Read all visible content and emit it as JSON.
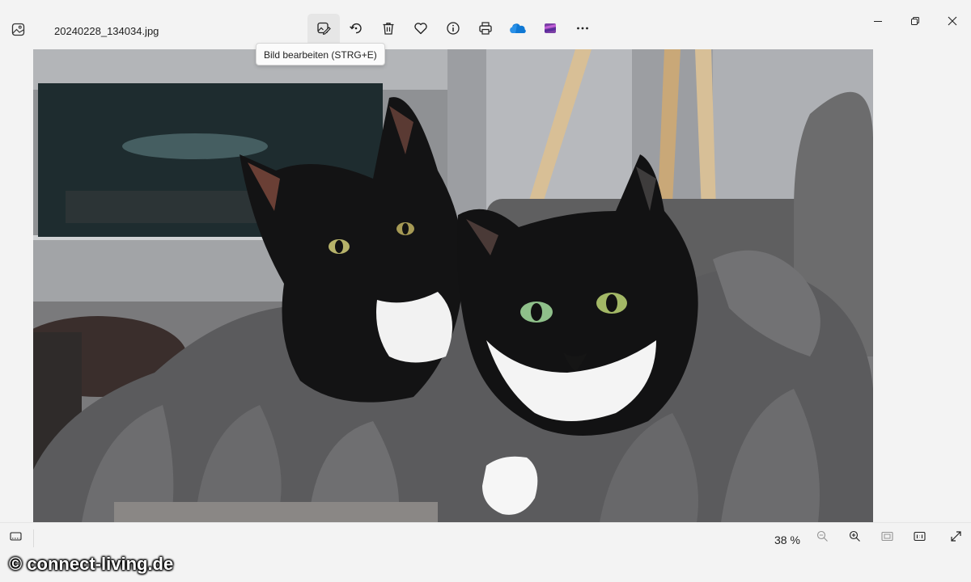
{
  "titlebar": {
    "filename": "20240228_134034.jpg"
  },
  "toolbar": {
    "buttons": [
      {
        "name": "edit-image",
        "icon": "edit-image-icon",
        "active": true
      },
      {
        "name": "rotate",
        "icon": "rotate-icon"
      },
      {
        "name": "delete",
        "icon": "trash-icon"
      },
      {
        "name": "favorite",
        "icon": "heart-icon"
      },
      {
        "name": "info",
        "icon": "info-icon"
      },
      {
        "name": "print",
        "icon": "printer-icon"
      },
      {
        "name": "onedrive",
        "icon": "onedrive-cloud-icon"
      },
      {
        "name": "clipchamp",
        "icon": "clipchamp-icon"
      },
      {
        "name": "more",
        "icon": "more-icon"
      }
    ]
  },
  "tooltip": {
    "text": "Bild bearbeiten (STRG+E)"
  },
  "photo": {
    "subject": "two-black-and-white-cats-on-grey-blanket"
  },
  "statusbar": {
    "zoom_label": "38 %"
  },
  "watermark": {
    "text": "© connect-living.de"
  },
  "colors": {
    "onedrive": "#0f78d4",
    "clipchamp": "#7b3fa5",
    "background": "#f3f3f3"
  }
}
